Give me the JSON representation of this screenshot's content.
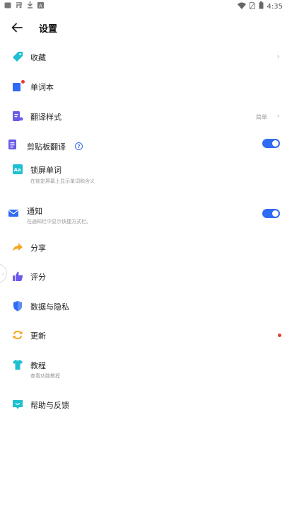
{
  "status_bar": {
    "time": "4:35",
    "left_icons": [
      "notification-icon",
      "app-icon",
      "download-icon",
      "translate-icon"
    ],
    "right_icons": [
      "wifi-icon",
      "sim-icon",
      "battery-icon"
    ]
  },
  "header": {
    "title": "设置"
  },
  "items": {
    "favorites": {
      "label": "收藏"
    },
    "wordbook": {
      "label": "单词本"
    },
    "translate_style": {
      "label": "翻译样式",
      "value": "简单"
    },
    "clipboard": {
      "label": "剪贴板翻译",
      "help": "?"
    },
    "lockscreen": {
      "label": "锁屏单词",
      "desc": "在锁定屏幕上显示单词和含义"
    },
    "notification": {
      "label": "通知",
      "desc": "在通知栏中显示快捷方式栏。"
    },
    "share": {
      "label": "分享"
    },
    "rate": {
      "label": "评分"
    },
    "privacy": {
      "label": "数据与隐私"
    },
    "update": {
      "label": "更新"
    },
    "tutorial": {
      "label": "教程",
      "desc": "查看功能教程"
    },
    "help": {
      "label": "帮助与反馈"
    }
  },
  "colors": {
    "accent": "#2f6bf5",
    "teal": "#1dbfd1",
    "orange": "#f5a623",
    "purple": "#6a5be8",
    "red_dot": "#e53935"
  }
}
